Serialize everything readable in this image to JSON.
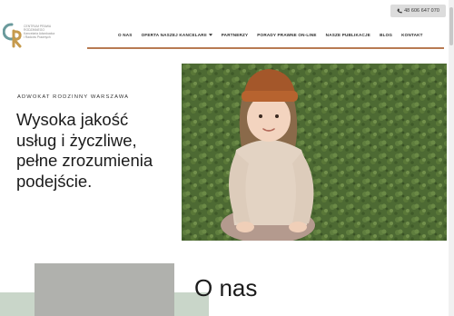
{
  "header": {
    "phone_label": "48 606 647 070",
    "logo_lines": [
      "CENTRUM PRAWA",
      "RODZINNEGO",
      "Kancelaria Adwokacka",
      "i Radców Prawnych"
    ]
  },
  "nav": {
    "items": [
      {
        "label": "O NAS"
      },
      {
        "label": "OFERTA NASZEJ KANCELARII"
      },
      {
        "label": "PARTNERZY"
      },
      {
        "label": "PORADY PRAWNE ON-LINE"
      },
      {
        "label": "NASZE PUBLIKACJE"
      },
      {
        "label": "BLOG"
      },
      {
        "label": "KONTAKT"
      }
    ]
  },
  "hero": {
    "eyebrow": "ADWOKAT RODZINNY WARSZAWA",
    "headline_lines": [
      "Wysoka jakość",
      "usług i życzliwe,",
      "pełne zrozumienia",
      "podejście."
    ]
  },
  "about": {
    "title": "O nas"
  },
  "colors": {
    "accent": "#b87a52",
    "sage": "#c9d6c9",
    "phone_bg": "#dcdcdc",
    "logo_teal": "#6a9a9c",
    "logo_gold": "#c69a4c"
  },
  "icons": [
    "phone-icon",
    "chevron-down-icon",
    "logo-mark"
  ]
}
